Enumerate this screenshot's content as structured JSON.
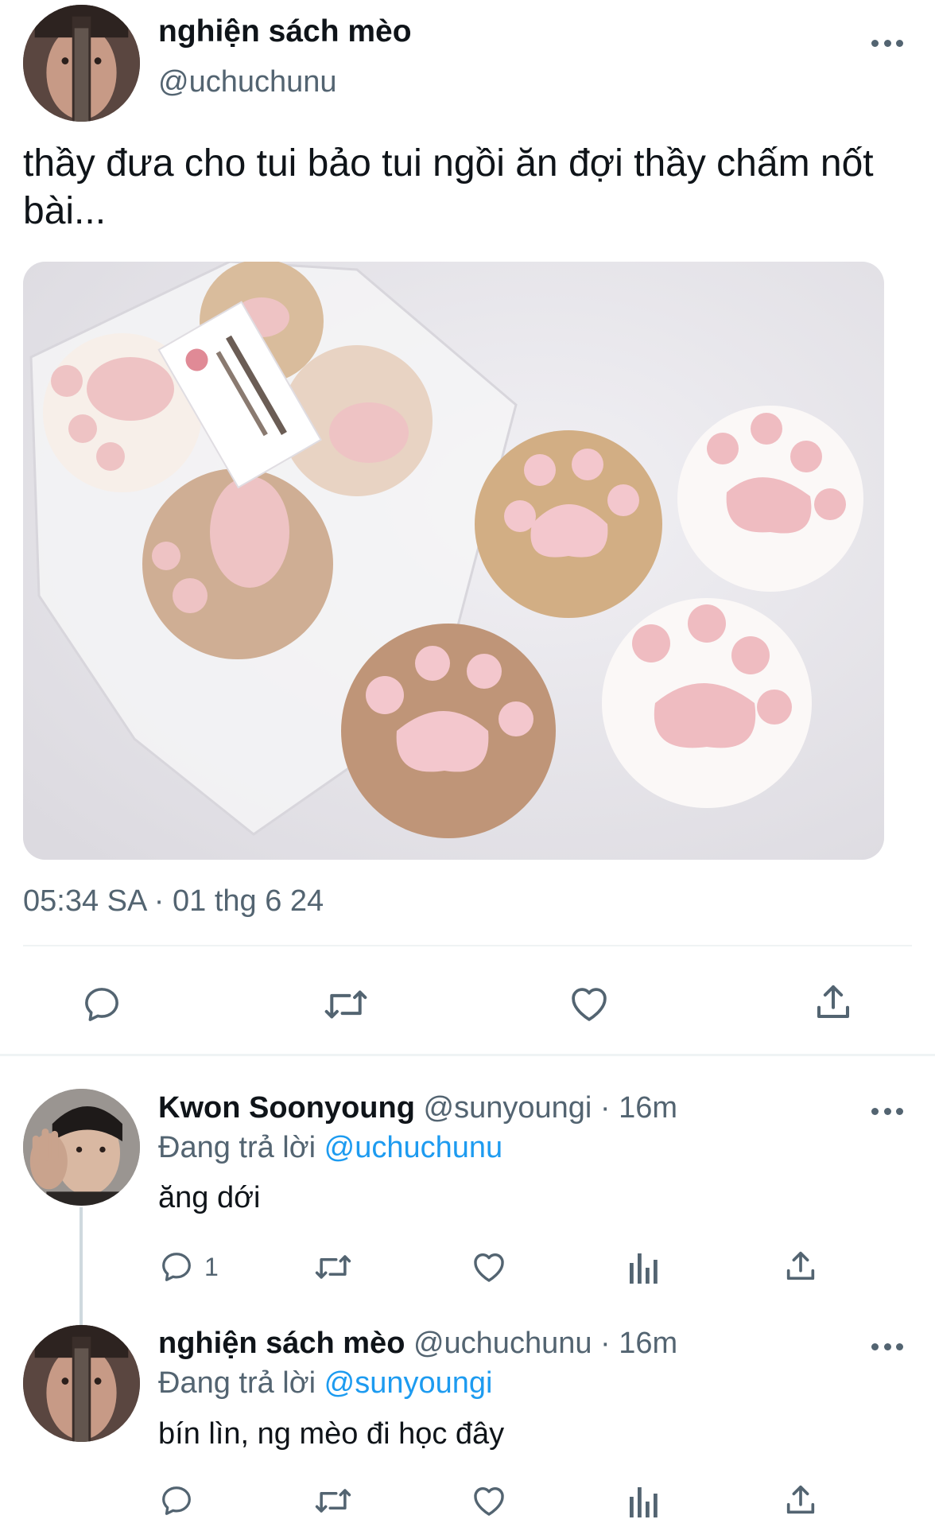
{
  "tweet": {
    "author_name": "nghiện sách mèo",
    "author_handle": "@uchuchunu",
    "avatar_icon": "avatar-photo",
    "text": "thầy đưa cho tui bảo tui ngồi ăn đợi thầy chấm nốt bài...",
    "image": "photo-cat-paw-marshmallows",
    "timestamp": "05:34 SA · 01 thg 6 24",
    "actions": [
      {
        "icon": "reply-icon"
      },
      {
        "icon": "retweet-icon"
      },
      {
        "icon": "like-icon"
      },
      {
        "icon": "share-icon"
      }
    ]
  },
  "replies": [
    {
      "author_name": "Kwon Soonyoung",
      "meta": "@sunyoungi · 16m",
      "replying_label": "Đang trả lời",
      "replying_to": "@uchuchunu",
      "text": "ăng dới",
      "reply_count": "1"
    },
    {
      "author_name": "nghiện sách mèo",
      "meta": "@uchuchunu · 16m",
      "replying_label": "Đang trả lời",
      "replying_to": "@sunyoungi",
      "text": "bín lìn, ng mèo đi học đây",
      "reply_count": ""
    }
  ],
  "colors": {
    "text": "#0f1419",
    "secondary": "#536471",
    "link": "#1d9bf0",
    "divider": "#eff3f4"
  }
}
